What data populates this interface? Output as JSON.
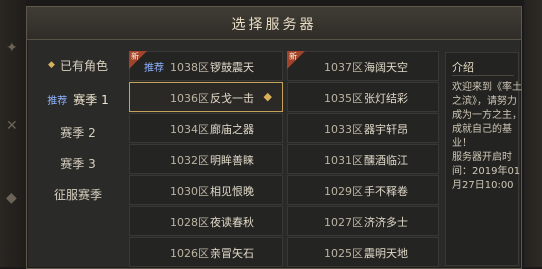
{
  "title": "选择服务器",
  "categories": [
    {
      "label": "已有角色",
      "icon": "diamond-icon"
    },
    {
      "label": "赛季 1",
      "tag": "推荐",
      "active": true
    },
    {
      "label": "赛季 2"
    },
    {
      "label": "赛季 3"
    },
    {
      "label": "征服赛季"
    }
  ],
  "servers_left": [
    {
      "num": "1038区",
      "name": "锣鼓震天",
      "tag": "推荐",
      "new": true,
      "new_label": "新"
    },
    {
      "num": "1036区",
      "name": "反戈一击",
      "selected": true
    },
    {
      "num": "1034区",
      "name": "廊庙之器"
    },
    {
      "num": "1032区",
      "name": "明眸善睐"
    },
    {
      "num": "1030区",
      "name": "相见恨晚"
    },
    {
      "num": "1028区",
      "name": "夜读春秋"
    },
    {
      "num": "1026区",
      "name": "亲冒矢石"
    }
  ],
  "servers_right": [
    {
      "num": "1037区",
      "name": "海阔天空",
      "new": true,
      "new_label": "新"
    },
    {
      "num": "1035区",
      "name": "张灯结彩"
    },
    {
      "num": "1033区",
      "name": "器宇轩昂"
    },
    {
      "num": "1031区",
      "name": "醺酒临江"
    },
    {
      "num": "1029区",
      "name": "手不释卷"
    },
    {
      "num": "1027区",
      "name": "济济多士"
    },
    {
      "num": "1025区",
      "name": "震明天地"
    }
  ],
  "info": {
    "heading": "介绍",
    "body": "欢迎来到《率土之滨》，请努力成为一方之主，成就自己的基业！\n服务器开启时间：2019年01月27日10:00"
  },
  "colors": {
    "accent_gold": "#c5a35b",
    "tag_blue": "#8fb2ff",
    "new_red": "#a2432c"
  }
}
